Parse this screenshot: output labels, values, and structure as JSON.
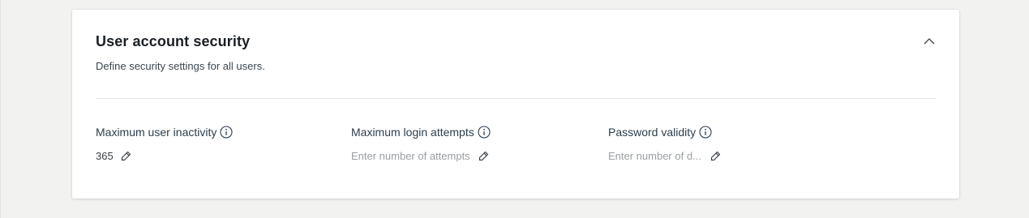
{
  "section": {
    "title": "User account security",
    "description": "Define security settings for all users.",
    "collapse_icon": "chevron-up-icon"
  },
  "fields": [
    {
      "label": "Maximum user inactivity",
      "value": "365",
      "placeholder": "",
      "info_icon": "info-icon",
      "edit_icon": "pencil-icon"
    },
    {
      "label": "Maximum login attempts",
      "value": "",
      "placeholder": "Enter number of attempts",
      "info_icon": "info-icon",
      "edit_icon": "pencil-icon"
    },
    {
      "label": "Password validity",
      "value": "",
      "placeholder": "Enter number of d...",
      "info_icon": "info-icon",
      "edit_icon": "pencil-icon"
    }
  ],
  "colors": {
    "background": "#f2f2f1",
    "card": "#ffffff",
    "title": "#1a1f24",
    "label": "#2c3e4d",
    "placeholder": "#9a9ea2"
  }
}
